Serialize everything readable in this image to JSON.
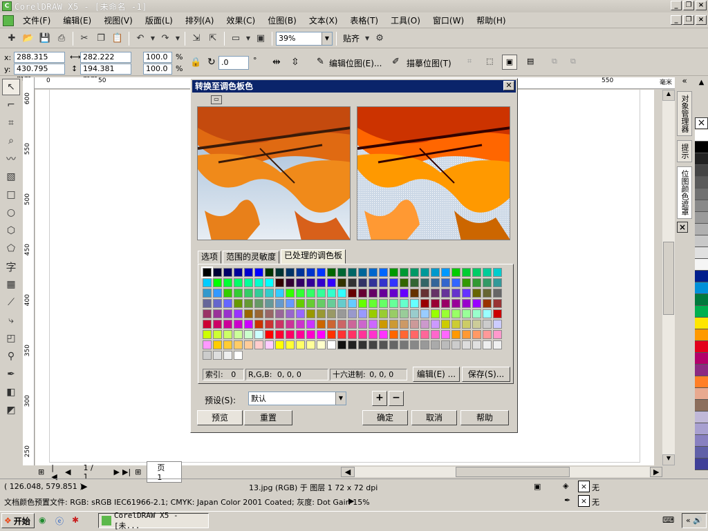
{
  "app": {
    "title": "CorelDRAW X5 - [未命名 -1]"
  },
  "menu": [
    "文件(F)",
    "编辑(E)",
    "视图(V)",
    "版面(L)",
    "排列(A)",
    "效果(C)",
    "位图(B)",
    "文本(X)",
    "表格(T)",
    "工具(O)",
    "窗口(W)",
    "帮助(H)"
  ],
  "toolbar": {
    "zoom": "39%",
    "snap": "贴齐"
  },
  "propbar": {
    "x": "288.315 mm",
    "y": "430.795 mm",
    "w": "282.222 mm",
    "h": "194.381 mm",
    "sx": "100.0",
    "sy": "100.0",
    "pct": "%",
    "angle": ".0",
    "deg": "°",
    "edit_bitmap": "编辑位图(E)...",
    "trace_bitmap": "描摹位图(T)"
  },
  "ruler": {
    "unit": "毫米",
    "h_ticks": [
      "0",
      "50",
      "550"
    ],
    "v_ticks": [
      "600",
      "550",
      "500",
      "450",
      "400",
      "350",
      "300",
      "250"
    ]
  },
  "dialog": {
    "title": "转换至调色板色",
    "tabs": [
      "选项",
      "范围的灵敏度",
      "已处理的调色板"
    ],
    "index_label": "索引:",
    "index_value": "0",
    "rgb_label": "R,G,B:",
    "rgb_value": "0,  0,  0",
    "hex_label": "十六进制:",
    "hex_value": "0, 0, 0",
    "edit_btn": "编辑(E) ...",
    "save_btn": "保存(S)...",
    "preset_label": "预设(S):",
    "preset_value": "默认",
    "preview_btn": "预览",
    "reset_btn": "重置",
    "ok_btn": "确定",
    "cancel_btn": "取消",
    "help_btn": "帮助",
    "palette_colors": [
      "#000000",
      "#000033",
      "#000066",
      "#000099",
      "#0000cc",
      "#0000ff",
      "#003300",
      "#003333",
      "#003366",
      "#003399",
      "#0033cc",
      "#0033ff",
      "#006600",
      "#006633",
      "#006666",
      "#006699",
      "#0066cc",
      "#0066ff",
      "#009900",
      "#009933",
      "#009966",
      "#009999",
      "#0099cc",
      "#0099ff",
      "#00cc00",
      "#00cc33",
      "#00cc66",
      "#00cc99",
      "#00cccc",
      "#00ccff",
      "#00ff00",
      "#00ff33",
      "#00ff66",
      "#00ff99",
      "#00ffcc",
      "#00ffff",
      "#330000",
      "#330033",
      "#330066",
      "#330099",
      "#3300cc",
      "#3300ff",
      "#333300",
      "#333333",
      "#333366",
      "#333399",
      "#3333cc",
      "#3333ff",
      "#336600",
      "#336633",
      "#336666",
      "#336699",
      "#3366cc",
      "#3366ff",
      "#339900",
      "#339933",
      "#339966",
      "#339999",
      "#3399cc",
      "#3399ff",
      "#33cc00",
      "#33cc33",
      "#33cc66",
      "#33cc99",
      "#33cccc",
      "#33ccff",
      "#33ff00",
      "#33ff33",
      "#33ff66",
      "#33ff99",
      "#33ffcc",
      "#33ffff",
      "#660000",
      "#660033",
      "#660066",
      "#660099",
      "#6600cc",
      "#6600ff",
      "#663300",
      "#663333",
      "#663366",
      "#663399",
      "#6633cc",
      "#6633ff",
      "#666600",
      "#666633",
      "#666666",
      "#666699",
      "#6666cc",
      "#6666ff",
      "#669900",
      "#669933",
      "#669966",
      "#669999",
      "#6699cc",
      "#6699ff",
      "#66cc00",
      "#66cc33",
      "#66cc66",
      "#66cc99",
      "#66cccc",
      "#66ccff",
      "#66ff00",
      "#66ff33",
      "#66ff66",
      "#66ff99",
      "#66ffcc",
      "#66ffff",
      "#990000",
      "#990033",
      "#990066",
      "#990099",
      "#9900cc",
      "#9900ff",
      "#993300",
      "#993333",
      "#993366",
      "#993399",
      "#9933cc",
      "#9933ff",
      "#996600",
      "#996633",
      "#996666",
      "#996699",
      "#9966cc",
      "#9966ff",
      "#999900",
      "#999933",
      "#999966",
      "#999999",
      "#9999cc",
      "#9999ff",
      "#99cc00",
      "#99cc33",
      "#99cc66",
      "#99cc99",
      "#99cccc",
      "#99ccff",
      "#99ff00",
      "#99ff33",
      "#99ff66",
      "#99ff99",
      "#99ffcc",
      "#99ffff",
      "#cc0000",
      "#cc0033",
      "#cc0066",
      "#cc0099",
      "#cc00cc",
      "#cc00ff",
      "#cc3300",
      "#cc3333",
      "#cc3366",
      "#cc3399",
      "#cc33cc",
      "#cc33ff",
      "#cc6600",
      "#cc6633",
      "#cc6666",
      "#cc6699",
      "#cc66cc",
      "#cc66ff",
      "#cc9900",
      "#cc9933",
      "#cc9966",
      "#cc9999",
      "#cc99cc",
      "#cc99ff",
      "#cccc00",
      "#cccc33",
      "#cccc66",
      "#cccc99",
      "#cccccc",
      "#ccccff",
      "#ccff00",
      "#ccff33",
      "#ccff66",
      "#ccff99",
      "#ccffcc",
      "#ccffff",
      "#ff0000",
      "#ff0033",
      "#ff0066",
      "#ff0099",
      "#ff00cc",
      "#ff00ff",
      "#ff3300",
      "#ff3333",
      "#ff3366",
      "#ff3399",
      "#ff33cc",
      "#ff33ff",
      "#ff6600",
      "#ff6633",
      "#ff6666",
      "#ff6699",
      "#ff66cc",
      "#ff66ff",
      "#ff9900",
      "#ff9933",
      "#ff9966",
      "#ff9999",
      "#ff99cc",
      "#ff99ff",
      "#ffcc00",
      "#ffcc33",
      "#ffcc66",
      "#ffcc99",
      "#ffcccc",
      "#ffccff",
      "#ffff00",
      "#ffff33",
      "#ffff66",
      "#ffff99",
      "#ffffcc",
      "#ffffff",
      "#111111",
      "#222222",
      "#333333",
      "#444444",
      "#555555",
      "#666666",
      "#777777",
      "#888888",
      "#999999",
      "#aaaaaa",
      "#bbbbbb",
      "#cccccc",
      "#dddddd",
      "#e0e0e0",
      "#eeeeee",
      "#f0f0f0",
      "#cccccc",
      "#dddddd",
      "#eeeeee",
      "#ffffff"
    ]
  },
  "docker": {
    "tab1": "对象管理器",
    "tab2": "提示",
    "tab3": "位图颜色遮罩"
  },
  "right_palette": [
    "#ffffff",
    "#000000",
    "#222222",
    "#444444",
    "#5a5a5a",
    "#707070",
    "#888888",
    "#9a9a9a",
    "#b0b0b0",
    "#c8c8c8",
    "#e0e0e0",
    "#f5f5f5",
    "#001e8c",
    "#0090d8",
    "#007a3d",
    "#00b04f",
    "#ffe600",
    "#ff9900",
    "#e3001b",
    "#b3006b",
    "#8c2a82",
    "#ff7f27",
    "#e8a98f",
    "#8c6e5c",
    "#c0b8d8",
    "#a8a0d0",
    "#8880c0",
    "#6060a8",
    "#404098"
  ],
  "pagenav": {
    "pages": "1 / 1",
    "tab": "页 1"
  },
  "status": {
    "coords": "( 126.048, 579.851 )",
    "object": "13.jpg (RGB) 于 图层 1 72 x 72 dpi",
    "profile": "文档颜色预置文件: RGB: sRGB IEC61966-2.1; CMYK: Japan Color 2001 Coated; 灰度: Dot Gain 15%",
    "fill_none": "无",
    "outline_none": "无"
  },
  "taskbar": {
    "start": "开始",
    "task": "CorelDRAW X5 - [未..."
  }
}
